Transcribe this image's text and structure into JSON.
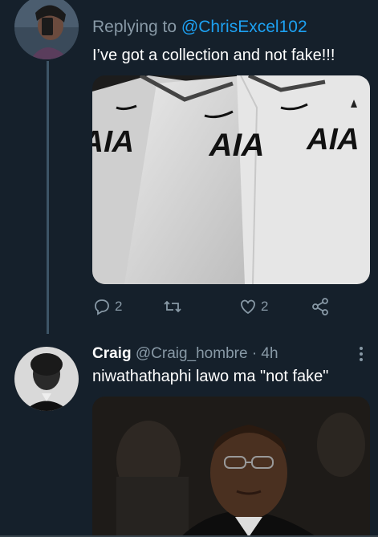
{
  "tweets": [
    {
      "reply_prefix": "Replying to",
      "reply_handle": "@ChrisExcel102",
      "text": "I’ve got a collection and not fake!!!",
      "image_text": "AIA",
      "actions": {
        "replies": "2",
        "likes": "2"
      }
    },
    {
      "name": "Craig",
      "handle": "@Craig_hombre",
      "time": "· 4h",
      "text": "niwathathaphi lawo ma \"not fake\""
    }
  ],
  "icons": [
    "reply-icon",
    "retweet-icon",
    "like-icon",
    "share-icon",
    "more-icon"
  ],
  "colors": {
    "background": "#15202b",
    "accent": "#1da1f2",
    "secondary_text": "#8899a6"
  }
}
